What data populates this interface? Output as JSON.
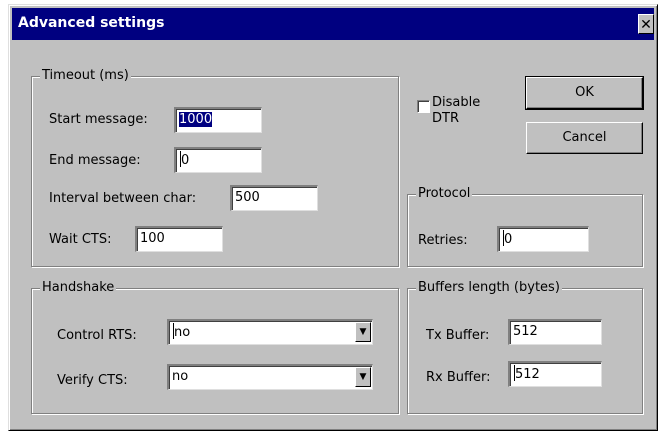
{
  "dialog": {
    "title": "Advanced settings",
    "close_glyph": "✕"
  },
  "timeout": {
    "group_label": "Timeout (ms)",
    "start_message": {
      "label": "Start message:",
      "value": "1000"
    },
    "end_message": {
      "label": "End message:",
      "value": "0"
    },
    "interval": {
      "label": "Interval between char:",
      "value": "500"
    },
    "wait_cts": {
      "label": "Wait CTS:",
      "value": "100"
    }
  },
  "disable_dtr": {
    "label_line1": "Disable",
    "label_line2": "DTR",
    "checked": false
  },
  "buttons": {
    "ok": "OK",
    "cancel": "Cancel"
  },
  "protocol": {
    "group_label": "Protocol",
    "retries": {
      "label": "Retries:",
      "value": "0"
    }
  },
  "handshake": {
    "group_label": "Handshake",
    "control_rts": {
      "label": "Control RTS:",
      "value": "no"
    },
    "verify_cts": {
      "label": "Verify CTS:",
      "value": "no"
    },
    "arrow_glyph": "▼"
  },
  "buffers": {
    "group_label": "Buffers length (bytes)",
    "tx": {
      "label": "Tx Buffer:",
      "value": "512"
    },
    "rx": {
      "label": "Rx Buffer:",
      "value": "512"
    }
  }
}
